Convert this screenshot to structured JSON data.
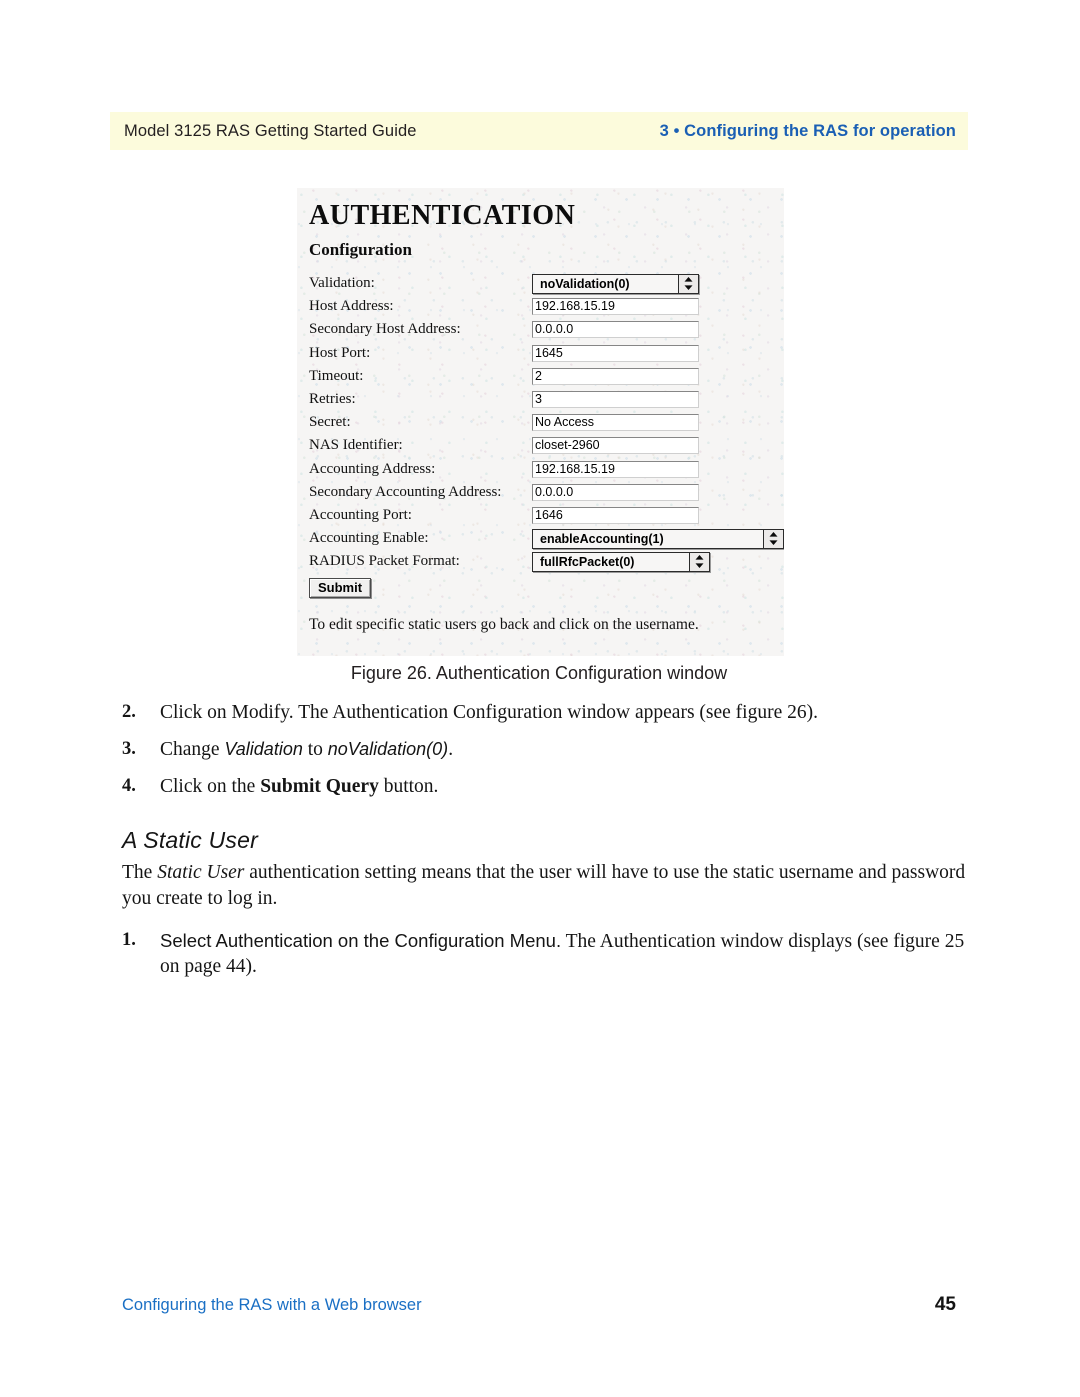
{
  "header": {
    "left": "Model 3125 RAS Getting Started Guide",
    "right": "3 • Configuring the RAS for operation",
    "band_color": "#fcfbdc",
    "accent_color": "#1a5fb4"
  },
  "figure": {
    "caption": "Figure 26. Authentication Configuration window",
    "window": {
      "title": "AUTHENTICATION",
      "subtitle": "Configuration",
      "fields": [
        {
          "label": "Validation:",
          "type": "select",
          "value": "noValidation(0)"
        },
        {
          "label": "Host Address:",
          "type": "text",
          "value": "192.168.15.19"
        },
        {
          "label": "Secondary Host Address:",
          "type": "text",
          "value": "0.0.0.0"
        },
        {
          "label": "Host Port:",
          "type": "text",
          "value": "1645"
        },
        {
          "label": "Timeout:",
          "type": "text",
          "value": "2"
        },
        {
          "label": "Retries:",
          "type": "text",
          "value": "3"
        },
        {
          "label": "Secret:",
          "type": "text",
          "value": "No Access"
        },
        {
          "label": "NAS Identifier:",
          "type": "text",
          "value": "closet-2960"
        },
        {
          "label": "Accounting Address:",
          "type": "text",
          "value": "192.168.15.19"
        },
        {
          "label": "Secondary Accounting Address:",
          "type": "text",
          "value": "0.0.0.0"
        },
        {
          "label": "Accounting Port:",
          "type": "text",
          "value": "1646"
        },
        {
          "label": "Accounting Enable:",
          "type": "select",
          "value": "enableAccounting(1)"
        },
        {
          "label": "RADIUS Packet Format:",
          "type": "select",
          "value": "fullRfcPacket(0)"
        }
      ],
      "submit_label": "Submit",
      "note": "To edit specific static users go back and click on the username."
    }
  },
  "steps": [
    {
      "num": "2.",
      "parts": [
        {
          "t": "Click on Modify. The Authentication Configuration window appears (see figure 26).",
          "style": "plain"
        }
      ]
    },
    {
      "num": "3.",
      "parts": [
        {
          "t": "Change ",
          "style": "plain"
        },
        {
          "t": "Validation",
          "style": "italic-sans"
        },
        {
          "t": " to ",
          "style": "plain"
        },
        {
          "t": "noValidation(0)",
          "style": "italic-sans"
        },
        {
          "t": ".",
          "style": "plain"
        }
      ]
    },
    {
      "num": "4.",
      "parts": [
        {
          "t": "Click on the ",
          "style": "plain"
        },
        {
          "t": "Submit Query",
          "style": "bold"
        },
        {
          "t": " button.",
          "style": "plain"
        }
      ]
    }
  ],
  "section": {
    "heading": "A Static User",
    "paragraph_parts": [
      {
        "t": "The ",
        "style": "plain"
      },
      {
        "t": "Static User",
        "style": "italic"
      },
      {
        "t": " authentication setting means that the user will have to use the static username and password you create to log in.",
        "style": "plain"
      }
    ],
    "steps": [
      {
        "num": "1.",
        "parts": [
          {
            "t": "Select Authentication on the Configuration Menu.",
            "style": "sans"
          },
          {
            "t": " The Authentication window displays (see figure 25 on page 44).",
            "style": "plain"
          }
        ]
      }
    ]
  },
  "footer": {
    "left": "Configuring the RAS with a Web browser",
    "page": "45",
    "link_color": "#1a6fc4"
  }
}
